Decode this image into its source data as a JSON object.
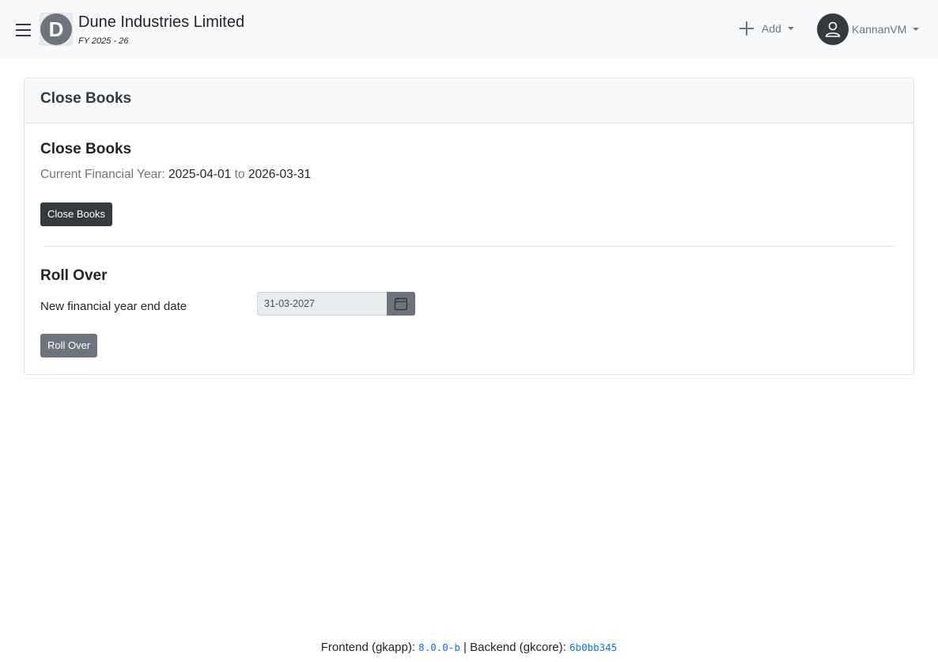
{
  "header": {
    "logo_letter": "D",
    "org_name": "Dune Industries Limited",
    "financial_year": "FY 2025 - 26",
    "add_label": "Add",
    "user_name": "KannanVM"
  },
  "card": {
    "header_title": "Close Books",
    "close_books": {
      "title": "Close Books",
      "fy_prefix": "Current Financial Year:",
      "fy_start": "2025-04-01",
      "fy_to": "to",
      "fy_end": "2026-03-31",
      "button_label": "Close Books"
    },
    "roll_over": {
      "title": "Roll Over",
      "field_label": "New financial year end date",
      "date_value": "31-03-2027",
      "button_label": "Roll Over"
    }
  },
  "footer": {
    "frontend_label": "Frontend (gkapp):",
    "frontend_version": "8.0.0-b",
    "separator": "|",
    "backend_label": "Backend (gkcore):",
    "backend_version": "6b0bb345"
  },
  "colors": {
    "navbar_bg": "#f8f9fa",
    "dark_button": "#343a40",
    "secondary_button": "#6c757d",
    "link_blue": "#0d6efd"
  },
  "icons": [
    "hamburger-icon",
    "plus-icon",
    "user-icon",
    "calendar-icon"
  ]
}
